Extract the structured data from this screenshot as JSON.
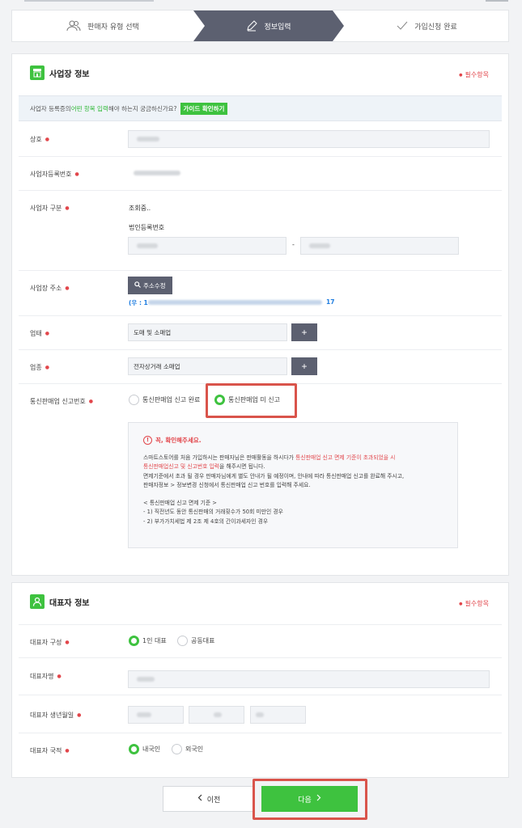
{
  "steps": [
    {
      "label": "판매자 유형 선택",
      "icon": "users-icon"
    },
    {
      "label": "정보입력",
      "icon": "pencil-icon"
    },
    {
      "label": "가입신청 완료",
      "icon": "check-icon"
    }
  ],
  "business": {
    "title": "사업장 정보",
    "required_label": "필수항목",
    "guide_prefix": "사업자 등록증의 ",
    "guide_highlight": "어떤 항목 입력",
    "guide_suffix": "해야 하는지 궁금하신가요?",
    "guide_button": "가이드 확인하기",
    "fields": {
      "name_label": "상호",
      "regno_label": "사업자등록번호",
      "type_label": "사업자 구분",
      "type_status": "조회중..",
      "corp_regno_label": "법인등록번호",
      "corp_dash": "-",
      "address_label": "사업장 주소",
      "address_button": "주소수정",
      "zip_prefix": "(우 : 1",
      "zip_suffix": "17",
      "biz_category_label": "업태",
      "biz_category_value": "도매 및 소매업",
      "biz_item_label": "업종",
      "biz_item_value": "전자상거래 소매업",
      "plus": "+",
      "mail_order_label": "통신판매업 신고번호",
      "mail_order_options": [
        "통신판매업 신고 완료",
        "통신판매업 미 신고"
      ],
      "mail_order_selected": 1
    },
    "notice": {
      "title": "꼭, 확인해주세요.",
      "p1_a": "스마트스토어를 처음 가입하시는 판매자님은 판매활동을 하시다가 ",
      "p1_red1": "통신판매업 신고 면제 기준이 초과되었을 시",
      "p1_red2": "통신판매업신고 및 신고번호 입력",
      "p1_b": "을 해주시면 됩니다.",
      "p2": "면제기준에서 초과 될 경우 판매자님에게 별도 안내가 될 예정이며, 안내에 따라 통신판매업 신고를 완료해 주시고,",
      "p3": "판매자정보 > 정보변경 신청에서 통신판매업 신고 번호를 입력해 주세요.",
      "criteria_title": "< 통신판매업 신고 면제 기준 >",
      "c1": "- 1) 직전년도 동안 통신판매의 거래횟수가 50회 미만인 경우",
      "c2": "- 2) 부가가치세법 제 2조 제 4호의 간이과세자인 경우"
    }
  },
  "representative": {
    "title": "대표자 정보",
    "required_label": "필수항목",
    "composition_label": "대표자 구성",
    "composition_options": [
      "1인 대표",
      "공동대표"
    ],
    "name_label": "대표자명",
    "birth_label": "대표자 생년월일",
    "nationality_label": "대표자 국적",
    "nationality_options": [
      "내국인",
      "외국인"
    ]
  },
  "nav": {
    "prev": "이전",
    "next": "다음"
  },
  "colors": {
    "accent": "#3ec23f",
    "required": "#e2464b",
    "active_step": "#5c6070",
    "highlight_box": "#d9544b"
  }
}
